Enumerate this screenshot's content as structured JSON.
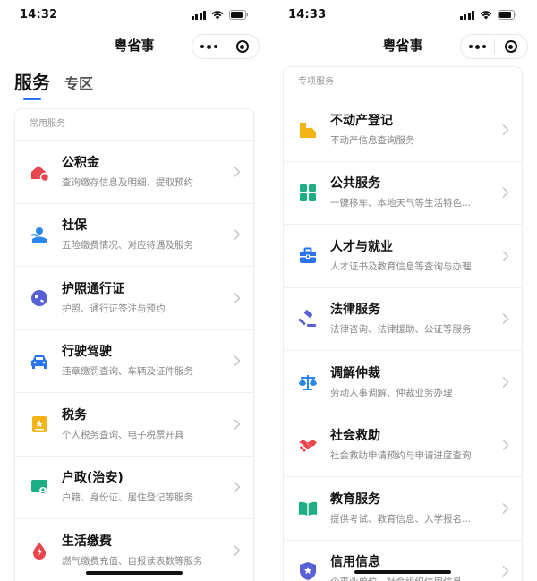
{
  "left": {
    "time": "14:32",
    "title": "粤省事",
    "tabs": [
      {
        "label": "服务"
      },
      {
        "label": "专区"
      }
    ],
    "card_header": "常用服务",
    "items": [
      {
        "title": "公积金",
        "subtitle": "查询缴存信息及明细、提取预约",
        "icon": "house-fund-icon",
        "color": "#e8454c"
      },
      {
        "title": "社保",
        "subtitle": "五险缴费情况、对应待遇及服务",
        "icon": "social-security-icon",
        "color": "#2b86f0"
      },
      {
        "title": "护照通行证",
        "subtitle": "护照、通行证签注与预约",
        "icon": "globe-icon",
        "color": "#5860d8"
      },
      {
        "title": "行驶驾驶",
        "subtitle": "违章缴罚查询、车辆及证件服务",
        "icon": "car-icon",
        "color": "#2b74f0"
      },
      {
        "title": "税务",
        "subtitle": "个人税务查询、电子税票开具",
        "icon": "tax-icon",
        "color": "#f5b416"
      },
      {
        "title": "户政(治安)",
        "subtitle": "户籍、身份证、居住登记等服务",
        "icon": "household-icon",
        "color": "#1dae84"
      },
      {
        "title": "生活缴费",
        "subtitle": "燃气缴费充值、自报读表数等服务",
        "icon": "utility-payment-icon",
        "color": "#e8454c"
      }
    ]
  },
  "right": {
    "time": "14:33",
    "title": "粤省事",
    "card_header": "专项服务",
    "items": [
      {
        "title": "不动产登记",
        "subtitle": "不动产信息查询服务",
        "icon": "real-estate-icon",
        "color": "#f5b416"
      },
      {
        "title": "公共服务",
        "subtitle": "一键移车、本地天气等生活特色...",
        "icon": "grid-icon",
        "color": "#1dae84"
      },
      {
        "title": "人才与就业",
        "subtitle": "人才证书及教育信息等查询与办理",
        "icon": "briefcase-icon",
        "color": "#2b74f0"
      },
      {
        "title": "法律服务",
        "subtitle": "法律咨询、法律援助、公证等服务",
        "icon": "gavel-icon",
        "color": "#5860d8"
      },
      {
        "title": "调解仲裁",
        "subtitle": "劳动人事调解、仲裁业务办理",
        "icon": "scales-icon",
        "color": "#2b86f0"
      },
      {
        "title": "社会救助",
        "subtitle": "社会救助申请预约与申请进度查询",
        "icon": "handshake-icon",
        "color": "#e8454c"
      },
      {
        "title": "教育服务",
        "subtitle": "提供考试、教育信息、入学报名...",
        "icon": "book-icon",
        "color": "#1dae84"
      },
      {
        "title": "信用信息",
        "subtitle": "企事业单位、社会组织信用信息...",
        "icon": "credit-shield-icon",
        "color": "#5860d8"
      }
    ]
  }
}
